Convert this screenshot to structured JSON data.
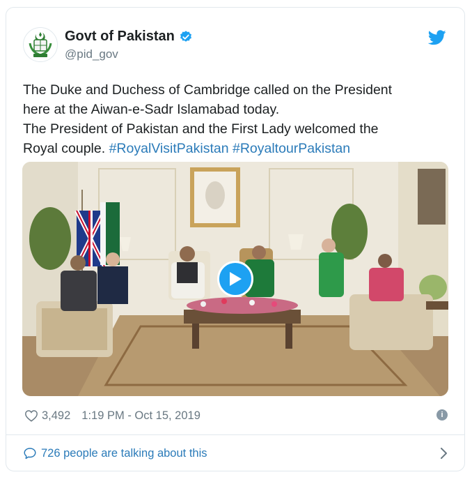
{
  "account": {
    "name": "Govt of Pakistan",
    "handle": "@pid_gov",
    "verified_icon": "verified-badge-icon",
    "brand_icon": "twitter-bird-icon"
  },
  "tweet": {
    "line1": "The Duke and Duchess of Cambridge called on the President",
    "line2": "here at the Aiwan-e-Sadr Islamabad today.",
    "line3": "The President of Pakistan and the First Lady welcomed the",
    "line4_text": "Royal couple. ",
    "hashtag1": "#RoyalVisitPakistan",
    "hashtag_sep": " ",
    "hashtag2": "#RoyaltourPakistan"
  },
  "media": {
    "type": "video",
    "play_icon": "play-icon"
  },
  "meta": {
    "like_icon": "heart-icon",
    "likes": "3,492",
    "timestamp": "1:19 PM - Oct 15, 2019",
    "info_icon": "info-icon",
    "info_glyph": "i"
  },
  "footer": {
    "icon": "speech-bubble-icon",
    "text": "726 people are talking about this",
    "chevron_icon": "chevron-right-icon"
  },
  "colors": {
    "link": "#2b7bb9",
    "brand": "#1da1f2",
    "muted": "#697882",
    "border": "#e1e8ed"
  }
}
